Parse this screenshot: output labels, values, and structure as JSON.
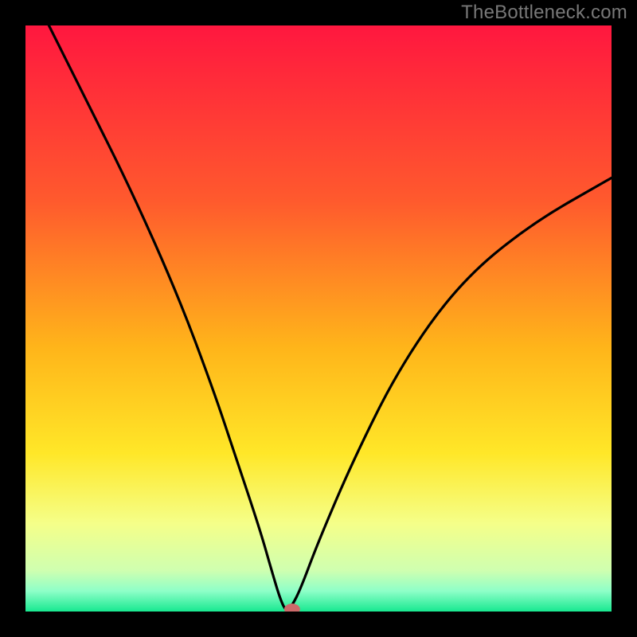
{
  "watermark": "TheBottleneck.com",
  "chart_data": {
    "type": "line",
    "title": "",
    "xlabel": "",
    "ylabel": "",
    "xlim": [
      0,
      100
    ],
    "ylim": [
      0,
      100
    ],
    "x": [
      4,
      10,
      18,
      26,
      32,
      36,
      40,
      42,
      43.5,
      44.5,
      45.5,
      47,
      50,
      56,
      64,
      74,
      86,
      100
    ],
    "values": [
      100,
      88,
      72,
      54,
      38,
      26,
      14,
      7,
      2,
      0,
      1,
      4,
      12,
      26,
      42,
      56,
      66,
      74
    ],
    "marker": {
      "x": 45.5,
      "y": 0.4
    },
    "gradient_stops": [
      {
        "offset": 0,
        "color": "#ff173f"
      },
      {
        "offset": 0.3,
        "color": "#ff5a2d"
      },
      {
        "offset": 0.55,
        "color": "#ffb51a"
      },
      {
        "offset": 0.73,
        "color": "#ffe728"
      },
      {
        "offset": 0.85,
        "color": "#f5ff89"
      },
      {
        "offset": 0.93,
        "color": "#cfffb0"
      },
      {
        "offset": 0.965,
        "color": "#8effc8"
      },
      {
        "offset": 1.0,
        "color": "#18e890"
      }
    ]
  }
}
